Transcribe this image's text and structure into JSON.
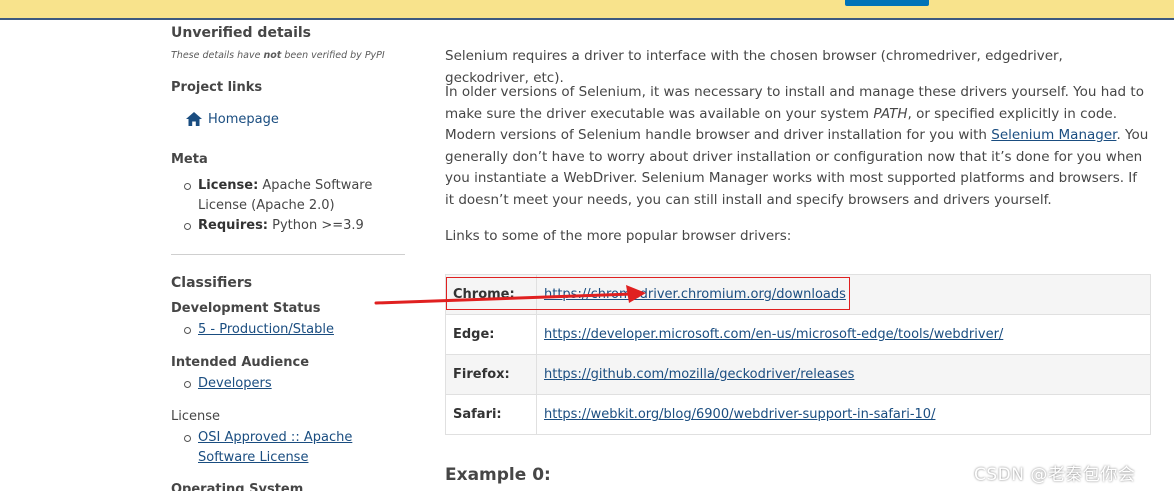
{
  "sidebar": {
    "unverified_heading": "Unverified details",
    "unverified_note_before": "These details have ",
    "unverified_note_bold": "not",
    "unverified_note_after": " been verified by PyPI",
    "project_links_heading": "Project links",
    "homepage_label": "Homepage",
    "meta_heading": "Meta",
    "meta_license_label": "License:",
    "meta_license_value": " Apache Software License (Apache 2.0)",
    "meta_requires_label": "Requires:",
    "meta_requires_value": " Python >=3.9",
    "classifiers_heading": "Classifiers",
    "dev_status_heading": "Development Status",
    "dev_status_link": "5 - Production/Stable",
    "audience_heading": "Intended Audience",
    "audience_link": "Developers",
    "license_heading": "License",
    "license_link": "OSI Approved :: Apache Software License",
    "os_heading": "Operating System"
  },
  "main": {
    "para1": "Selenium requires a driver to interface with the chosen browser (chromedriver, edgedriver, geckodriver, etc).",
    "para2_a": "In older versions of Selenium, it was necessary to install and manage these drivers yourself. You had to make sure the driver executable was available on your system ",
    "para2_path": "PATH",
    "para2_b": ", or specified explicitly in code. Modern versions of Selenium handle browser and driver installation for you with ",
    "para2_link": "Selenium Manager",
    "para2_c": ". You generally don’t have to worry about driver installation or configuration now that it’s done for you when you instantiate a WebDriver. Selenium Manager works with most supported platforms and browsers. If it doesn’t meet your needs, you can still install and specify browsers and drivers yourself.",
    "para3": "Links to some of the more popular browser drivers:",
    "drivers": [
      {
        "name": "Chrome:",
        "url": "https://chromedriver.chromium.org/downloads"
      },
      {
        "name": "Edge:",
        "url": "https://developer.microsoft.com/en-us/microsoft-edge/tools/webdriver/"
      },
      {
        "name": "Firefox:",
        "url": "https://github.com/mozilla/geckodriver/releases"
      },
      {
        "name": "Safari:",
        "url": "https://webkit.org/blog/6900/webdriver-support-in-safari-10/"
      }
    ],
    "example_heading": "Example 0:"
  },
  "watermark": "CSDN @老秦包你会",
  "colors": {
    "banner": "#f8e38c",
    "link": "#1a4d80",
    "annotation_red": "#e02020"
  }
}
